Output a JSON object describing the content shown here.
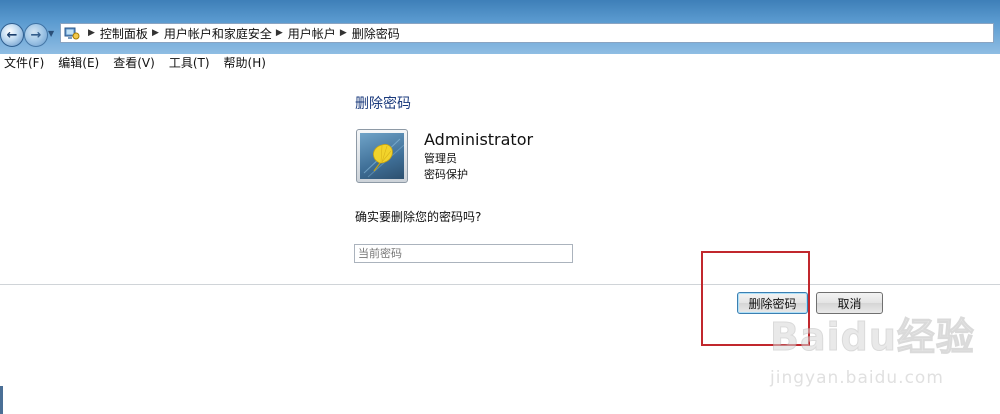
{
  "breadcrumb": [
    "控制面板",
    "用户帐户和家庭安全",
    "用户帐户",
    "删除密码"
  ],
  "menu": [
    "文件(F)",
    "编辑(E)",
    "查看(V)",
    "工具(T)",
    "帮助(H)"
  ],
  "page": {
    "title": "删除密码",
    "user_name": "Administrator",
    "user_role": "管理员",
    "user_status": "密码保护",
    "question": "确实要删除您的密码吗?",
    "password_placeholder": "当前密码"
  },
  "buttons": {
    "delete": "删除密码",
    "cancel": "取消"
  },
  "watermark": {
    "brand": "Baidu经验",
    "url": "jingyan.baidu.com"
  },
  "colors": {
    "title_text": "#1a3a7c",
    "highlight": "#c1272d",
    "titlebar": "#5b9bd0"
  }
}
